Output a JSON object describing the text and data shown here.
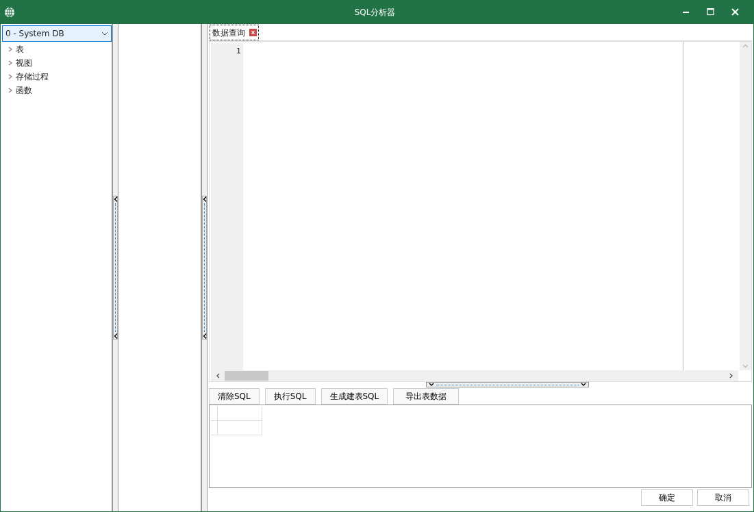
{
  "window": {
    "title": "SQL分析器"
  },
  "database_select": {
    "value": "0 - System DB"
  },
  "tree": [
    {
      "label": "表",
      "expanded": false
    },
    {
      "label": "视图",
      "expanded": false
    },
    {
      "label": "存储过程",
      "expanded": false
    },
    {
      "label": "函数",
      "expanded": false
    }
  ],
  "tabs": [
    {
      "label": "数据查询",
      "selected": true
    }
  ],
  "editor": {
    "line_numbers": [
      "1"
    ]
  },
  "toolbar_buttons": [
    "清除SQL",
    "执行SQL",
    "生成建表SQL",
    "导出表数据"
  ],
  "footer_buttons": [
    "确定",
    "取消"
  ]
}
